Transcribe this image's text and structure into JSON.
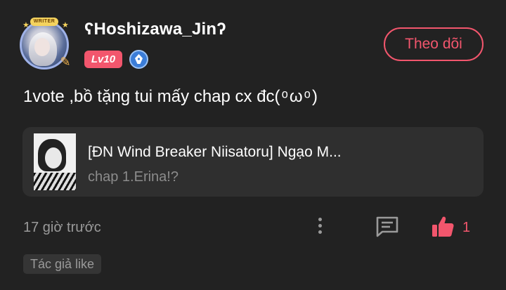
{
  "user": {
    "badge_text": "WRITER",
    "username": "ʕHoshizawa_Jinʔ",
    "level": "Lv10",
    "follow_label": "Theo dõi"
  },
  "comment": {
    "text": "1vote ,bồ tặng tui mấy chap cx đc(‎ ͦ ‎ω‎ ͦ )"
  },
  "story": {
    "title": "[ĐN Wind Breaker Niisatoru] Ngạo M...",
    "chapter": "chap 1.Erina!?"
  },
  "meta": {
    "timestamp": "17 giờ trước",
    "like_count": "1",
    "tag": "Tác giả like"
  },
  "colors": {
    "background": "#222222",
    "accent": "#f2566d",
    "card": "#2f2f2f",
    "muted_text": "#9a9a9a"
  },
  "icons": {
    "more": "more-vertical-icon",
    "reply": "comment-icon",
    "like": "thumbs-up-icon",
    "role": "pen-nib-icon"
  }
}
